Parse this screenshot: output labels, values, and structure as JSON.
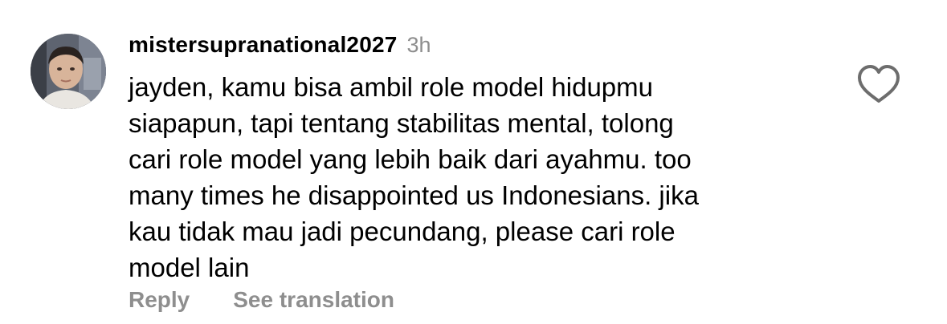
{
  "comment": {
    "username": "mistersupranational2027",
    "timestamp": "3h",
    "text_lines": [
      "jayden, kamu bisa ambil role model hidupmu",
      "siapapun, tapi tentang stabilitas mental, tolong",
      "cari role model yang lebih baik dari ayahmu. too",
      "many times he disappointed us Indonesians. jika",
      "kau tidak mau jadi pecundang, please cari role",
      "model lain"
    ],
    "avatar_icon": "profile-photo",
    "like_icon": "heart-outline-icon"
  },
  "actions": {
    "reply_label": "Reply",
    "translate_label": "See translation"
  },
  "colors": {
    "text": "#000000",
    "muted": "#8e8e8e",
    "background": "#ffffff"
  }
}
